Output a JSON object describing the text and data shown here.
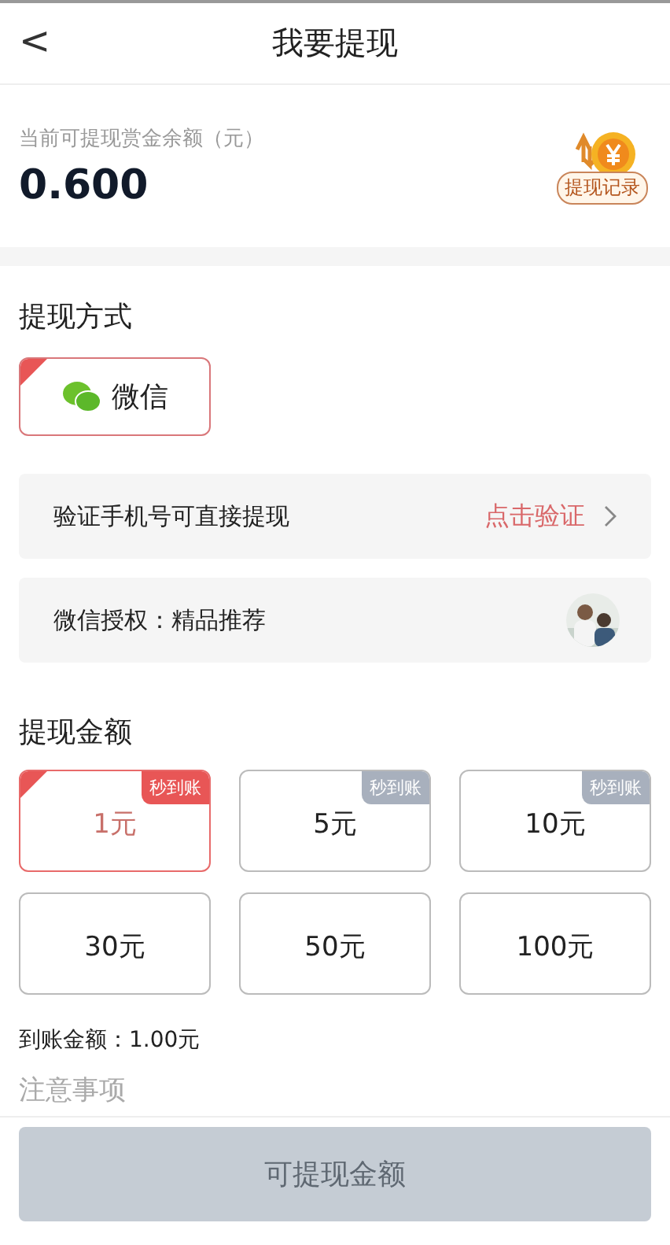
{
  "header": {
    "back": "<",
    "title": "我要提现"
  },
  "balance": {
    "label": "当前可提现赏金余额（元）",
    "amount": "0.600",
    "records_button": "提现记录"
  },
  "method": {
    "heading": "提现方式",
    "options": [
      {
        "label": "微信",
        "selected": true
      }
    ]
  },
  "rows": [
    {
      "kind": "link",
      "label": "验证手机号可直接提现",
      "action": "点击验证"
    },
    {
      "kind": "avatar",
      "label": "微信授权：精品推荐"
    }
  ],
  "amount": {
    "heading": "提现金额",
    "options": [
      {
        "label": "1元",
        "badge": "秒到账",
        "selected": true
      },
      {
        "label": "5元",
        "badge": "秒到账",
        "selected": false
      },
      {
        "label": "10元",
        "badge": "秒到账",
        "selected": false
      },
      {
        "label": "30元",
        "selected": false
      },
      {
        "label": "50元",
        "selected": false
      },
      {
        "label": "100元",
        "selected": false
      }
    ],
    "received": "到账金额：1.00元"
  },
  "notes_heading": "注意事项",
  "submit": {
    "label": "可提现金额",
    "disabled": true
  }
}
